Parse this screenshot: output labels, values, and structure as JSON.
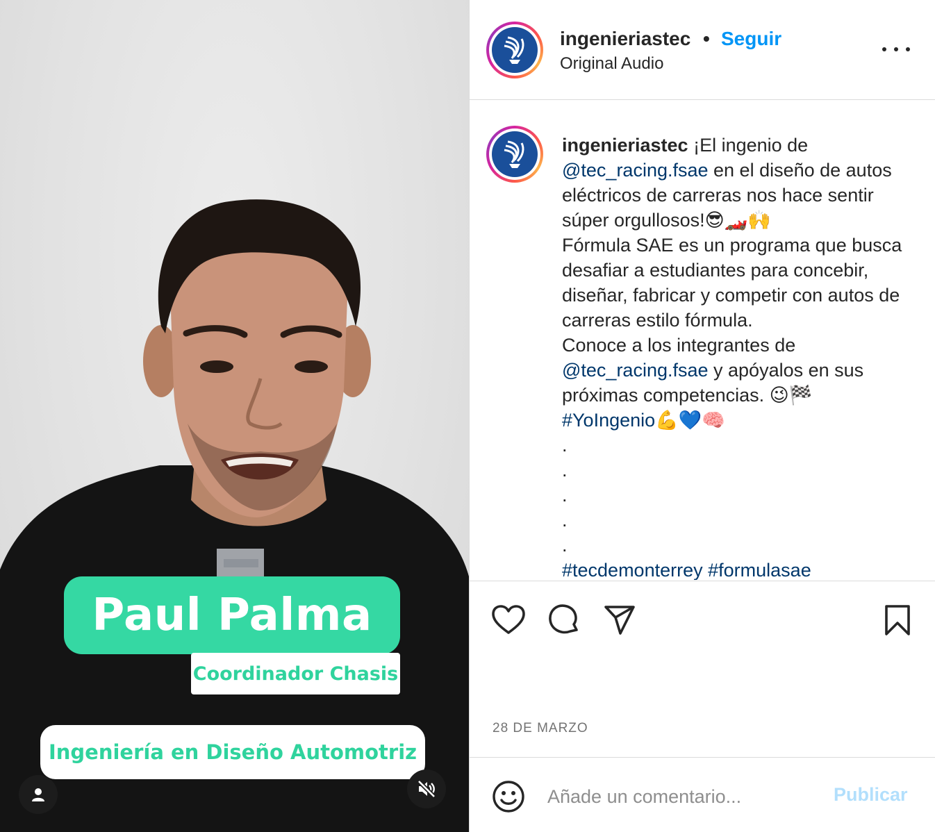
{
  "video": {
    "name_card": "Paul Palma",
    "role_card": "Coordinador Chasis",
    "program_card": "Ingeniería en Diseño Automotriz",
    "user_icon": "user-icon",
    "mute_icon": "muted-speaker-icon"
  },
  "header": {
    "username": "ingenieriastec",
    "separator": "•",
    "follow_label": "Seguir",
    "audio": "Original Audio",
    "more_icon": "more-horizontal-icon"
  },
  "caption": {
    "username": "ingenieriastec",
    "part1": " ¡El ingenio de ",
    "mention1": "@tec_racing.fsae",
    "part2": " en el diseño de autos eléctricos de carreras nos hace sentir súper orgullosos!😎🏎️🙌",
    "part3": "Fórmula SAE es un programa que busca desafiar a estudiantes para concebir, diseñar, fabricar y competir con autos de carreras estilo fórmula.",
    "part4": "Conoce a los integrantes de ",
    "mention2": "@tec_racing.fsae",
    "part5": " y apóyalos en sus próximas competencias. 😉🏁",
    "hashtag1": "#YoIngenio",
    "hashtag1_emoji": "💪💙🧠",
    "dot": ".",
    "hashtag2": "#tecdemonterrey",
    "hashtag3": "#formulasae"
  },
  "actions": {
    "like_icon": "heart-icon",
    "comment_icon": "comment-icon",
    "share_icon": "send-icon",
    "save_icon": "bookmark-icon"
  },
  "date": "28 DE MARZO",
  "comment": {
    "placeholder": "Añade un comentario...",
    "emoji_icon": "smiley-icon",
    "publish_label": "Publicar"
  },
  "colors": {
    "follow_blue": "#0095f6",
    "link_blue": "#00376b",
    "publish_disabled": "#b2dffc",
    "card_green": "#35d8a3",
    "text_green": "#2fd39d",
    "logo_blue": "#1a4f9a"
  }
}
